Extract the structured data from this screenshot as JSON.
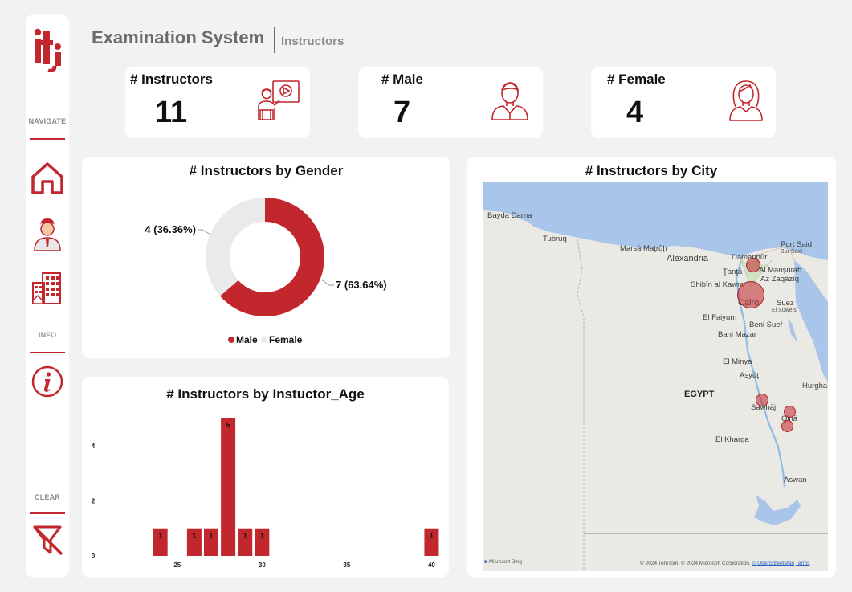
{
  "sidebar": {
    "logo": "iti",
    "navigate_label": "NAVIGATE",
    "info_label": "INFO",
    "clear_label": "CLEAR"
  },
  "header": {
    "title": "Examination System",
    "subtitle": "Instructors"
  },
  "kpis": {
    "instructors": {
      "label": "# Instructors",
      "value": "11",
      "icon": "teacher-presentation-icon"
    },
    "male": {
      "label": "# Male",
      "value": "7",
      "icon": "male-person-icon"
    },
    "female": {
      "label": "# Female",
      "value": "4",
      "icon": "female-person-icon"
    }
  },
  "colors": {
    "accent": "#c1272d",
    "female": "#eaeaea",
    "sea": "#a9c6ea",
    "land": "#ebe9e4"
  },
  "gender_chart": {
    "title": "# Instructors by Gender",
    "male_label": "7 (63.64%)",
    "female_label": "4 (36.36%)",
    "legend": [
      "Male",
      "Female"
    ]
  },
  "age_chart": {
    "title": "# Instructors by Instuctor_Age",
    "y_ticks": [
      "0",
      "2",
      "4"
    ],
    "x_ticks": [
      "25",
      "30",
      "35",
      "40"
    ]
  },
  "map": {
    "title": "# Instructors by City",
    "places": {
      "bayda": "Bayda Darna",
      "tubruq": "Tubruq",
      "marsa": "Marsá Maţrūḩ",
      "alexandria": "Alexandria",
      "damanhur": "Damanhūr",
      "tanta": "Ţanţā",
      "almansurah": "Al Manşūrah",
      "portsaid": "Port Said",
      "portsaid_ar": "Bur Said",
      "shibin": "Shibīn al Kawm",
      "azzaqaziq": "Az Zaqāzīq",
      "cairo": "Cairo",
      "suez": "Suez",
      "suez_ar": "El Suweis",
      "faiyum": "El Faiyum",
      "benisuef": "Beni Suef",
      "banimazar": "Bani Mazar",
      "minya": "El Minya",
      "asyut": "Asyūţ",
      "egypt": "EGYPT",
      "sawhaj": "Sawhāj",
      "qina": "Qinā",
      "hurghada": "Hurgha",
      "kharga": "El Kharga",
      "aswan": "Aswan"
    },
    "footer_bing": "Microsoft Bing",
    "footer_copy": "© 2024 TomTom, © 2024 Microsoft Corporation, ",
    "footer_osm": "© OpenStreetMap",
    "footer_terms": "Terms"
  },
  "chart_data": [
    {
      "type": "pie",
      "title": "# Instructors by Gender",
      "categories": [
        "Male",
        "Female"
      ],
      "values": [
        7,
        4
      ],
      "labels": [
        "7 (63.64%)",
        "4 (36.36%)"
      ],
      "colors": [
        "#c1272d",
        "#eaeaea"
      ],
      "legend": "bottom"
    },
    {
      "type": "bar",
      "title": "# Instructors by Instuctor_Age",
      "x": [
        24,
        26,
        27,
        28,
        29,
        30,
        40
      ],
      "values": [
        1,
        1,
        1,
        5,
        1,
        1,
        1
      ],
      "xlim": [
        22.5,
        40.5
      ],
      "ylim": [
        0,
        5.4
      ],
      "x_ticks": [
        25,
        30,
        35,
        40
      ],
      "y_ticks": [
        0,
        2,
        4
      ],
      "grid": false
    }
  ]
}
